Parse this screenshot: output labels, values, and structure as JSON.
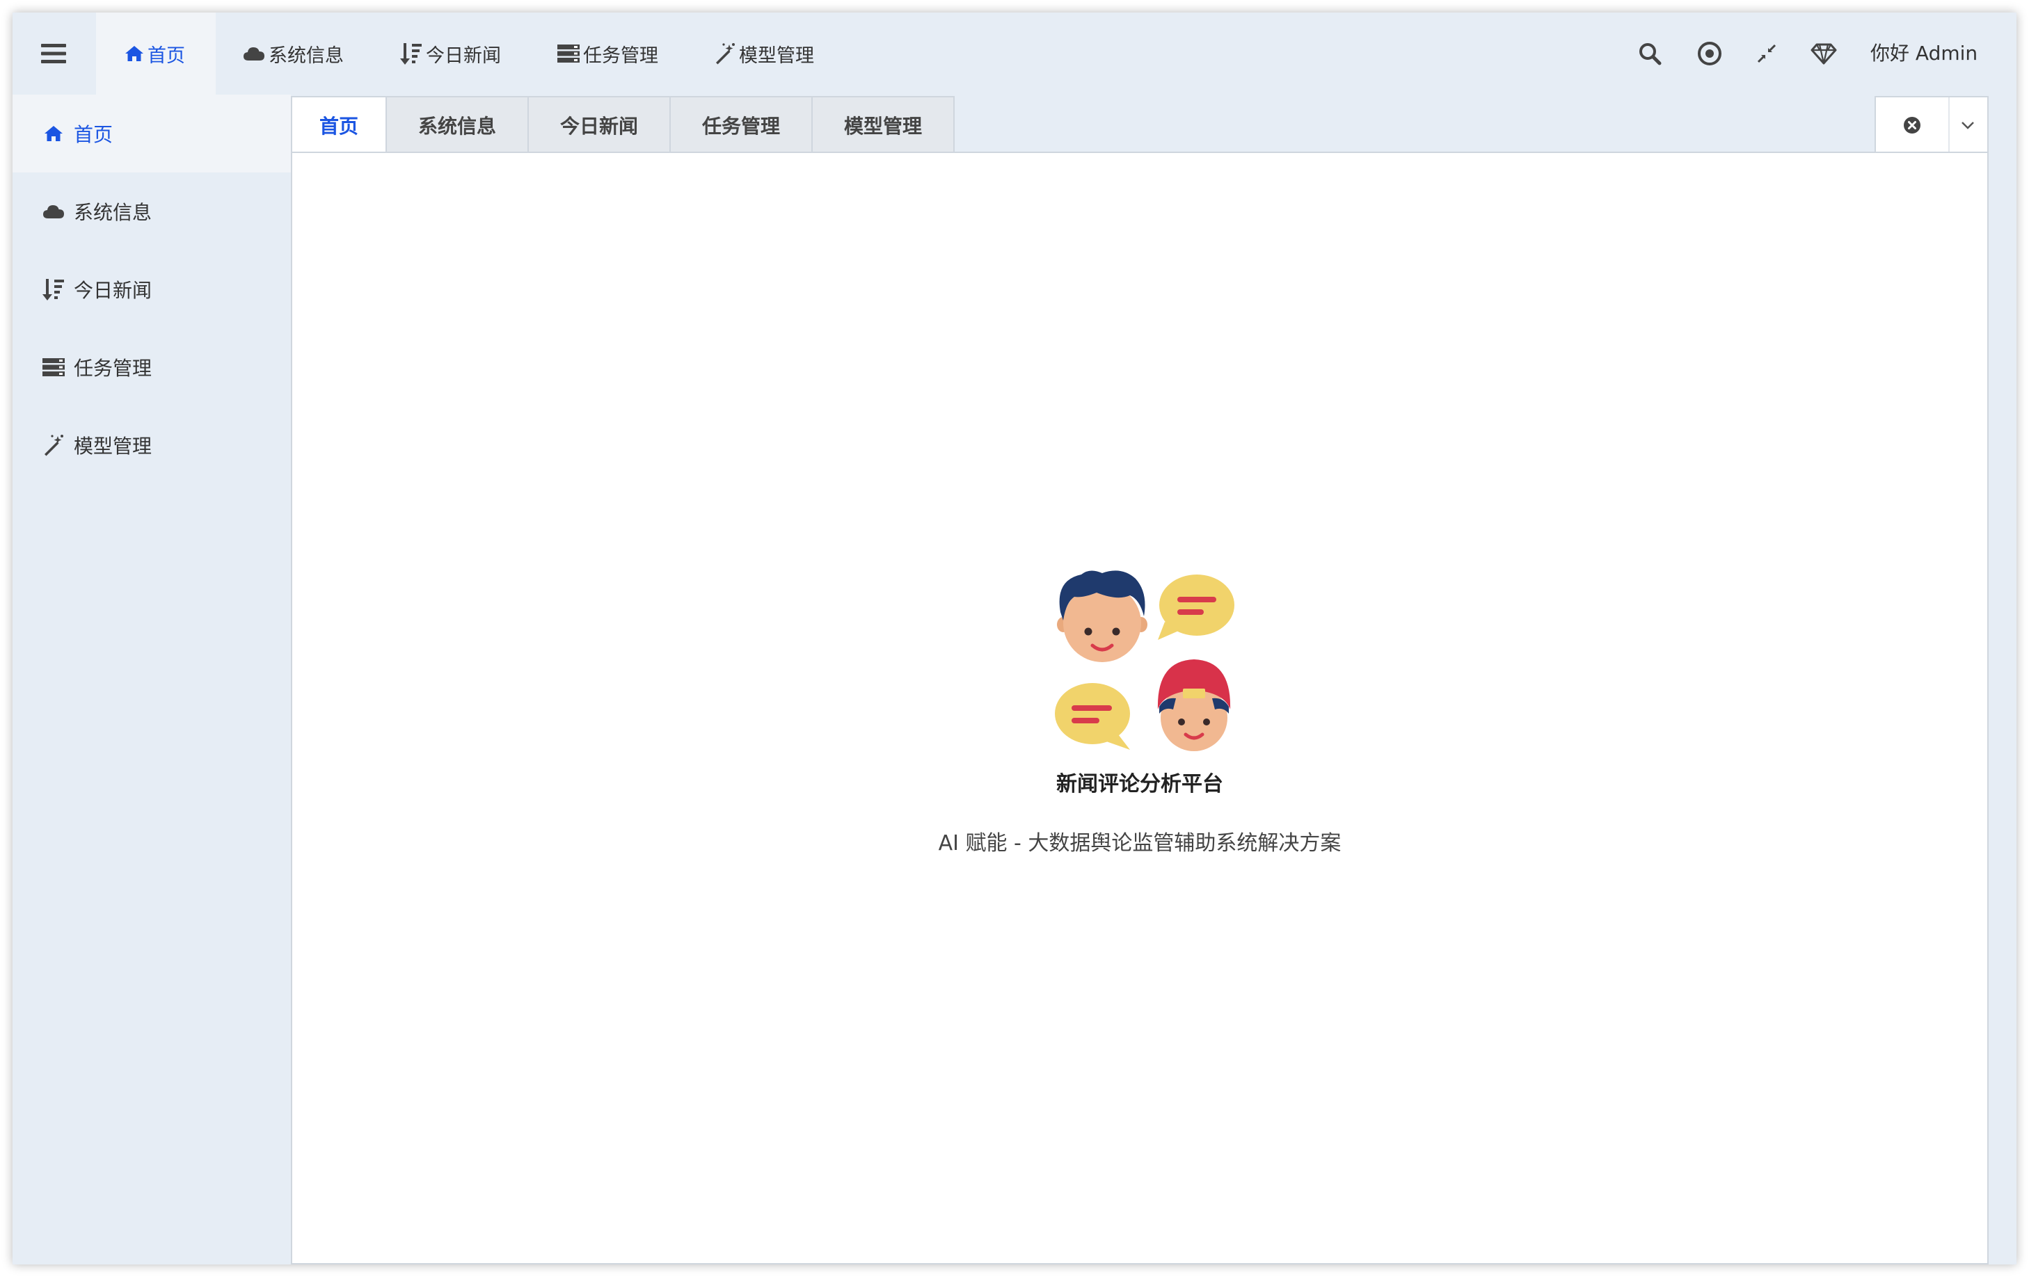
{
  "colors": {
    "accent": "#1b55e2",
    "text": "#333333",
    "background": "#e6edf5"
  },
  "header": {
    "menu_icon": "hamburger-icon",
    "nav": [
      {
        "label": "首页",
        "icon": "home-icon"
      },
      {
        "label": "系统信息",
        "icon": "cloud-icon"
      },
      {
        "label": "今日新闻",
        "icon": "sort-icon"
      },
      {
        "label": "任务管理",
        "icon": "server-icon"
      },
      {
        "label": "模型管理",
        "icon": "magic-wand-icon"
      }
    ],
    "tools": [
      "search-icon",
      "target-icon",
      "compress-icon",
      "diamond-icon"
    ],
    "greeting": "你好 Admin"
  },
  "sidebar": {
    "items": [
      {
        "label": "首页",
        "icon": "home-icon"
      },
      {
        "label": "系统信息",
        "icon": "cloud-icon"
      },
      {
        "label": "今日新闻",
        "icon": "sort-icon"
      },
      {
        "label": "任务管理",
        "icon": "server-icon"
      },
      {
        "label": "模型管理",
        "icon": "magic-wand-icon"
      }
    ]
  },
  "tabs": [
    {
      "label": "首页"
    },
    {
      "label": "系统信息"
    },
    {
      "label": "今日新闻"
    },
    {
      "label": "任务管理"
    },
    {
      "label": "模型管理"
    }
  ],
  "main": {
    "title": "新闻评论分析平台",
    "subtitle": "AI 赋能 - 大数据舆论监管辅助系统解决方案"
  }
}
